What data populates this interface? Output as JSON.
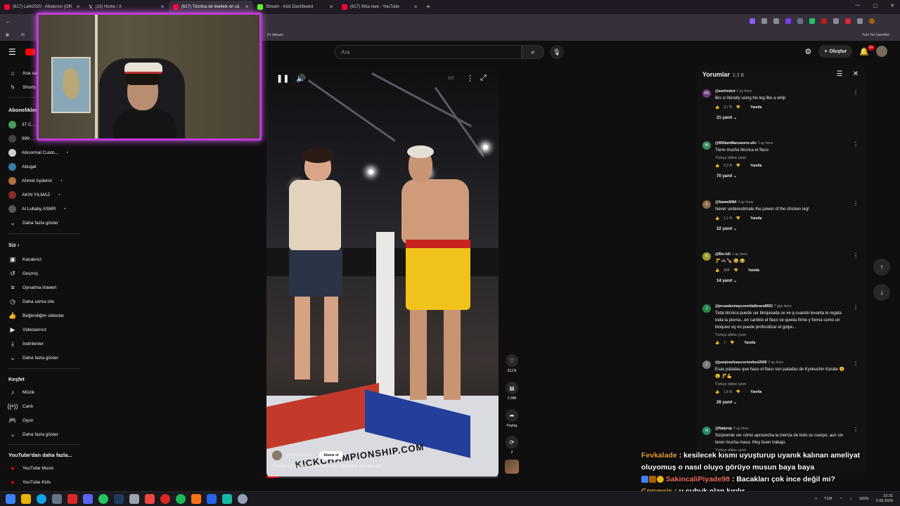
{
  "browser": {
    "tabs": [
      {
        "label": "(617) Lark2020 - Afedersin (Offi",
        "color": "#ff0033",
        "active": false
      },
      {
        "label": "(10) Home / X",
        "color": "#ffffff",
        "active": false
      },
      {
        "label": "(617) Técnica de lowkick en cá",
        "color": "#ff0033",
        "active": true
      },
      {
        "label": "Stream - Kick Dashboard",
        "color": "#53fc18",
        "active": false
      },
      {
        "label": "(617) Shia rave - YouTube",
        "color": "#ff0033",
        "active": false
      }
    ],
    "bookmarks": {
      "ai_label": "AI",
      "pc_label": "Pc bileşen",
      "all_label": "Tüm Yer İşaretleri"
    }
  },
  "youtube": {
    "search_placeholder": "Ara",
    "create_label": "Oluştur",
    "notif_count": "9+"
  },
  "sidebar": {
    "main": [
      {
        "label": "Ana sayfa",
        "icon": "home-icon"
      },
      {
        "label": "Shorts",
        "icon": "shorts-icon"
      }
    ],
    "subs_header": "Abonelikler",
    "subs": [
      {
        "label": "37 C…",
        "color": "#4a9a5a",
        "dot": false
      },
      {
        "label": "999 …",
        "color": "#444444",
        "dot": false
      },
      {
        "label": "Abnormal Custo...",
        "color": "#d0d0d0",
        "dot": true
      },
      {
        "label": "Abugat",
        "color": "#3a7aa8",
        "dot": false
      },
      {
        "label": "Ahmet Aydeniz",
        "color": "#b07040",
        "dot": true
      },
      {
        "label": "AKIN YILMAZ",
        "color": "#8a2a2a",
        "dot": true
      },
      {
        "label": "Al Lullaby ASMR",
        "color": "#555555",
        "dot": true
      }
    ],
    "subs_more": "Daha fazla göster",
    "you_header": "Siz",
    "you": [
      {
        "label": "Kanalınız",
        "icon": "channel-icon"
      },
      {
        "label": "Geçmiş",
        "icon": "history-icon"
      },
      {
        "label": "Oynatma listeleri",
        "icon": "playlist-icon"
      },
      {
        "label": "Daha sonra izle",
        "icon": "clock-icon"
      },
      {
        "label": "Beğendiğim videolar",
        "icon": "like-icon"
      },
      {
        "label": "Videolarınız",
        "icon": "video-icon"
      },
      {
        "label": "İndirilenler",
        "icon": "download-icon"
      }
    ],
    "you_more": "Daha fazla göster",
    "explore_header": "Keşfet",
    "explore": [
      {
        "label": "Müzik",
        "icon": "music-icon"
      },
      {
        "label": "Canlı",
        "icon": "live-icon"
      },
      {
        "label": "Oyun",
        "icon": "gaming-icon"
      }
    ],
    "explore_more": "Daha fazla göster",
    "more_header": "YouTube'dan daha fazla...",
    "more": [
      {
        "label": "YouTube Music"
      },
      {
        "label": "YouTube Kids"
      }
    ]
  },
  "video": {
    "channel": "@eduardoghk1",
    "subscribe_label": "Abone ol",
    "title_plain": "Técnica de lowkick en cámara lenta ",
    "hashtags": "#lowkick #k1 #karate",
    "floor_text": "KICKCHAMPIONSHIP.COM",
    "progress_pct": 5,
    "actions": {
      "likes": "313 B",
      "comments": "2.388",
      "share": "Paylaş",
      "remix": "2"
    }
  },
  "comments": {
    "title": "Yorumlar",
    "count": "2,3 B",
    "items": [
      {
        "avatar": "RS",
        "color": "#6a3b7a",
        "author": "@axelrodcd",
        "when": "2 ay önce",
        "text": "Bro is literally using his leg like a whip",
        "translate": "",
        "likes": "3,7 B",
        "reply": "Yanıtla",
        "replies": "21 yanıt"
      },
      {
        "avatar": "W",
        "color": "#3a8a5a",
        "author": "@WilliamManzanero-u5v",
        "when": "2 ay önce",
        "text": "Tiene mucha técnica el flaco",
        "translate": "Türkçe diline çevir",
        "likes": "6,3 B",
        "reply": "Yanıtla",
        "replies": "70 yanıt"
      },
      {
        "avatar": "S",
        "color": "#8a6a4a",
        "author": "@Samw8484",
        "when": "2 ay önce",
        "text": "Never underestimate the power of the chicken leg!",
        "translate": "",
        "likes": "1,1 B",
        "reply": "Yanıtla",
        "replies": "22 yanıt"
      },
      {
        "avatar": "B",
        "color": "#9a9a2a",
        "author": "@Bio-b2t",
        "when": "1 ay önce",
        "text": "🦵 vs 🍗 😂 😂",
        "translate": "",
        "likes": "694",
        "reply": "Yanıtla",
        "replies": "14 yanıt"
      },
      {
        "avatar": "J",
        "color": "#2a8a4a",
        "author": "@jerusalenmayconvidalbravo8552",
        "when": "7 gün önce",
        "text": "Toda técnica puede ser bloqueada se ve q cuando levanta le regala toda la pierna...en cambio el flaco se queda firme y forma como un bloqueo xq no puede profundizar el golpe...",
        "translate": "Türkçe diline çevir",
        "likes": "7",
        "reply": "Yanıtla",
        "replies": ""
      },
      {
        "avatar": "J",
        "color": "#777777",
        "author": "@juanjosehuascorondinel2000",
        "when": "2 ay önce",
        "text": "Esas patadas que hace el flaco son patadas de Kyokushin Karate 😮 😮 🦵💪",
        "translate": "Türkçe diline çevir",
        "likes": "1,6 B",
        "reply": "Yanıtla",
        "replies": "26 yanıt"
      },
      {
        "avatar": "N",
        "color": "#2a8a6a",
        "author": "@Natprop",
        "when": "2 ay önce",
        "text": "Sorprende ver cómo aprovecha la inercia de todo su cuerpo, aun sin tener mucha masa. Muy buen trabajo.",
        "translate": "Türkçe diline çevir",
        "likes": "",
        "reply": "",
        "replies": ""
      }
    ]
  },
  "chat": [
    {
      "user": "Fevkalade",
      "sep": " : ",
      "msg": "kesilecek kısmı uyuşturup uyanık kalınan ameliyat oluyomuş o nasıl oluyo görüyo musun baya baya"
    },
    {
      "user": "SakincaliPiyade98",
      "sep": " : ",
      "msg": "Bacakları çok ince değil mi?"
    },
    {
      "user": "Corvexis",
      "sep": " : ",
      "msg": "u çubuk olan kırılır"
    }
  ],
  "taskbar": {
    "lang": "TUR",
    "battery": "100%",
    "time": "22:31",
    "date": "2.08.2026"
  },
  "colors": {
    "accent": "#ff0000",
    "cam_border": "#c03bd9"
  }
}
